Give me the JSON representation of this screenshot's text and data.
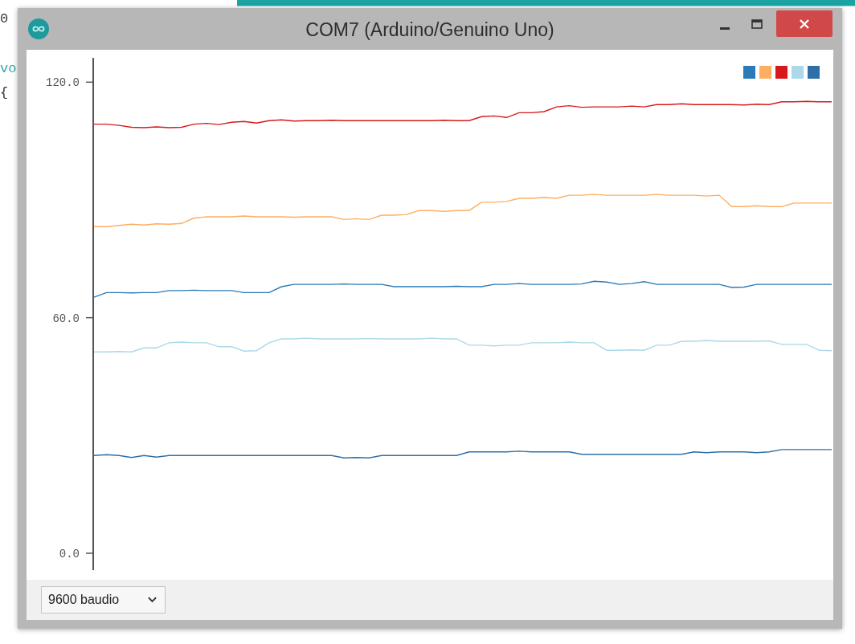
{
  "background": {
    "code_lines": [
      {
        "text": "0",
        "kind": "plain"
      },
      {
        "text": "vo",
        "kind": "keyword"
      },
      {
        "text": "{",
        "kind": "plain"
      }
    ]
  },
  "window": {
    "title": "COM7 (Arduino/Genuino Uno)",
    "plot": {
      "chart_data": {
        "type": "line",
        "ylim": [
          -4.3,
          126.2
        ],
        "yticks": [
          {
            "value": 0,
            "label": "0.0"
          },
          {
            "value": 60,
            "label": "60.0"
          },
          {
            "value": 120,
            "label": "120.0"
          }
        ],
        "series": [
          {
            "color": "#2c7bb6",
            "values": [
              65.2,
              66.4,
              66.4,
              66.3,
              66.4,
              66.4,
              66.9,
              66.9,
              67.0,
              66.9,
              66.9,
              66.9,
              66.4,
              66.4,
              66.4,
              67.9,
              68.5,
              68.5,
              68.5,
              68.5,
              68.6,
              68.5,
              68.5,
              68.5,
              67.9,
              67.9,
              67.9,
              67.9,
              67.9,
              68.0,
              67.9,
              67.9,
              68.5,
              68.5,
              68.7,
              68.5,
              68.5,
              68.5,
              68.5,
              68.6,
              69.3,
              69.1,
              68.5,
              68.7,
              69.2,
              68.5,
              68.5,
              68.5,
              68.5,
              68.5,
              68.5,
              67.7,
              67.8,
              68.5,
              68.5,
              68.5,
              68.5,
              68.5,
              68.5,
              68.5
            ]
          },
          {
            "color": "#fdae61",
            "values": [
              83.2,
              83.2,
              83.5,
              83.8,
              83.6,
              83.9,
              83.8,
              84.0,
              85.4,
              85.7,
              85.7,
              85.7,
              85.9,
              85.7,
              85.7,
              85.7,
              85.6,
              85.7,
              85.7,
              85.7,
              85.0,
              85.2,
              85.0,
              86.1,
              86.1,
              86.3,
              87.3,
              87.3,
              87.1,
              87.3,
              87.3,
              89.4,
              89.4,
              89.6,
              90.4,
              90.4,
              90.6,
              90.4,
              91.2,
              91.2,
              91.4,
              91.2,
              91.2,
              91.2,
              91.2,
              91.4,
              91.2,
              91.2,
              91.2,
              91.0,
              91.2,
              88.3,
              88.3,
              88.5,
              88.3,
              88.3,
              89.2,
              89.2,
              89.2,
              89.2
            ]
          },
          {
            "color": "#d7191c",
            "values": [
              109.3,
              109.3,
              109.0,
              108.5,
              108.4,
              108.6,
              108.4,
              108.5,
              109.3,
              109.5,
              109.2,
              109.8,
              110.0,
              109.6,
              110.2,
              110.4,
              110.1,
              110.2,
              110.2,
              110.3,
              110.2,
              110.2,
              110.2,
              110.2,
              110.2,
              110.2,
              110.2,
              110.2,
              110.3,
              110.2,
              110.2,
              111.2,
              111.4,
              111.0,
              112.2,
              112.2,
              112.5,
              113.7,
              114.0,
              113.6,
              113.7,
              113.7,
              113.7,
              113.9,
              113.7,
              114.3,
              114.3,
              114.5,
              114.3,
              114.3,
              114.3,
              114.3,
              114.2,
              114.4,
              114.3,
              115.0,
              115.0,
              115.1,
              115.0,
              115.0
            ]
          },
          {
            "color": "#abd9e9",
            "values": [
              51.3,
              51.3,
              51.4,
              51.3,
              52.3,
              52.3,
              53.6,
              53.8,
              53.6,
              53.6,
              52.6,
              52.6,
              51.5,
              51.6,
              53.6,
              54.6,
              54.6,
              54.8,
              54.6,
              54.6,
              54.6,
              54.6,
              54.7,
              54.6,
              54.6,
              54.6,
              54.6,
              54.8,
              54.6,
              54.6,
              53.0,
              53.0,
              52.8,
              53.0,
              53.0,
              53.6,
              53.6,
              53.6,
              53.8,
              53.6,
              53.6,
              51.7,
              51.7,
              51.8,
              51.7,
              53.0,
              53.0,
              54.0,
              54.0,
              54.2,
              54.0,
              54.0,
              54.0,
              54.0,
              54.1,
              53.2,
              53.2,
              53.2,
              51.7,
              51.6
            ]
          },
          {
            "color": "#2f6fa8",
            "values": [
              24.9,
              25.1,
              24.9,
              24.4,
              24.9,
              24.5,
              24.9,
              24.9,
              24.9,
              24.9,
              24.9,
              24.9,
              24.9,
              24.9,
              24.9,
              24.9,
              24.9,
              24.9,
              24.9,
              24.9,
              24.3,
              24.4,
              24.3,
              24.9,
              24.9,
              24.9,
              24.9,
              24.9,
              24.9,
              24.9,
              25.8,
              25.8,
              25.8,
              25.8,
              26.0,
              25.8,
              25.8,
              25.8,
              25.8,
              25.2,
              25.2,
              25.2,
              25.2,
              25.2,
              25.2,
              25.2,
              25.2,
              25.2,
              25.8,
              25.6,
              25.8,
              25.8,
              25.8,
              25.6,
              25.8,
              26.4,
              26.4,
              26.4,
              26.4,
              26.4
            ]
          }
        ]
      }
    },
    "baud_rate": {
      "value": "9600 baudio"
    }
  }
}
